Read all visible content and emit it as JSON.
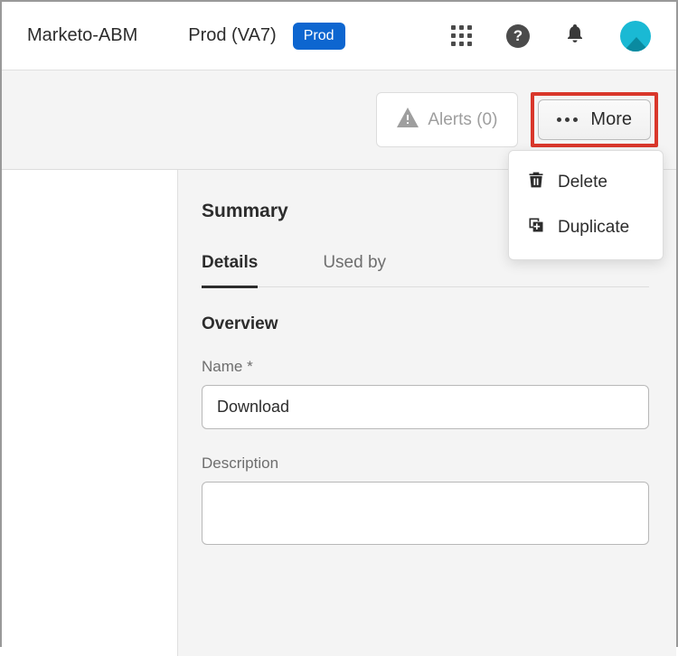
{
  "header": {
    "org": "Marketo-ABM",
    "env": "Prod (VA7)",
    "badge": "Prod"
  },
  "toolbar": {
    "alerts_label": "Alerts (0)",
    "more_label": "More"
  },
  "dropdown": {
    "delete_label": "Delete",
    "duplicate_label": "Duplicate"
  },
  "content": {
    "summary": "Summary",
    "tabs": {
      "details": "Details",
      "used_by": "Used by"
    },
    "overview": "Overview",
    "name_label": "Name *",
    "name_value": "Download",
    "description_label": "Description",
    "description_value": ""
  }
}
